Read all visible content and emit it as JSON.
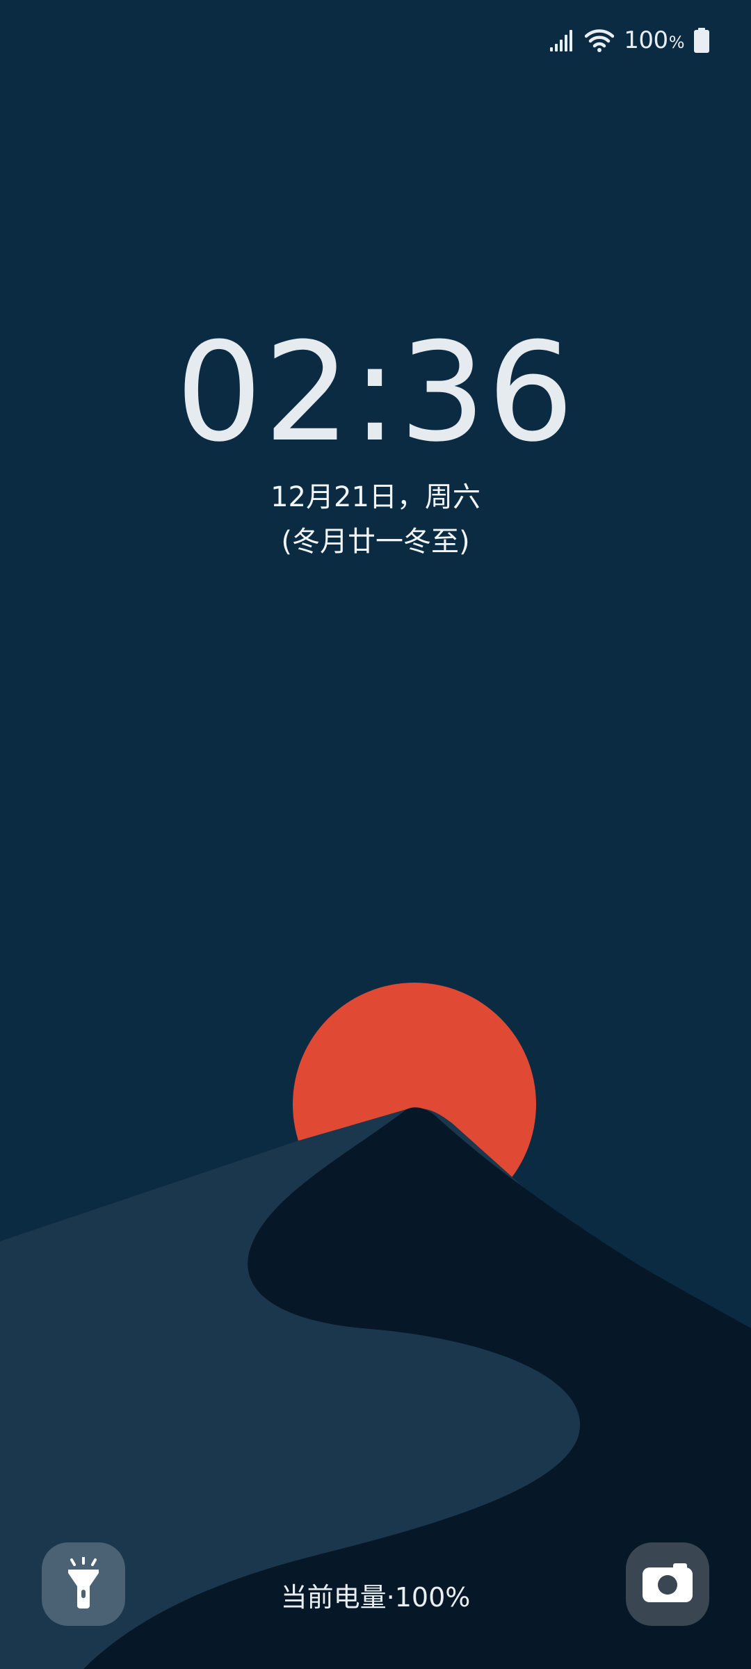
{
  "status_bar": {
    "signal_icon": "cellular-signal-icon",
    "wifi_icon": "wifi-icon",
    "battery_level": "100",
    "battery_unit": "%",
    "battery_icon": "battery-full-icon"
  },
  "lockscreen": {
    "time": "02:36",
    "date": "12月21日，周六",
    "lunar": "(冬月廿一冬至)",
    "battery_text": "当前电量·100%"
  },
  "shortcuts": {
    "left_icon": "flashlight-icon",
    "right_icon": "camera-icon"
  },
  "colors": {
    "sky": "#0b2b42",
    "sun": "#e04a35",
    "dune_light": "#1b374d",
    "dune_dark": "#061827"
  }
}
